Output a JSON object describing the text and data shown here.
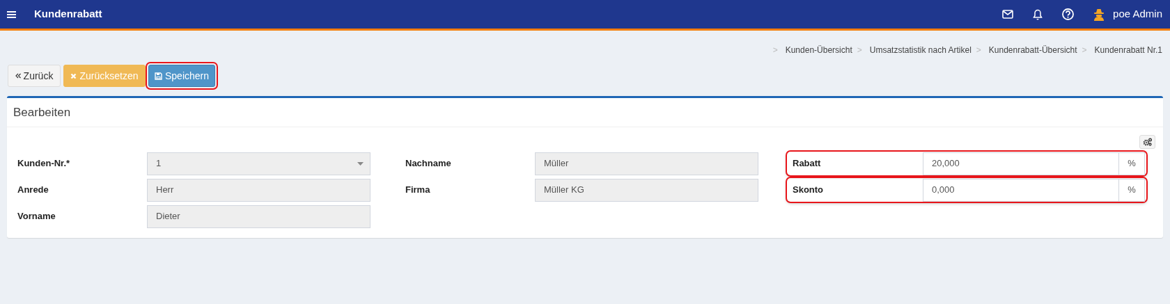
{
  "header": {
    "title": "Kundenrabatt",
    "user": "poe Admin"
  },
  "breadcrumb": [
    "Kunden-Übersicht",
    "Umsatzstatistik nach Artikel",
    "Kundenrabatt-Übersicht",
    "Kundenrabatt Nr.1"
  ],
  "breadcrumb_separator": ">",
  "buttons": [
    {
      "kind": "back",
      "label": "Zurück",
      "highlighted": false
    },
    {
      "kind": "reset",
      "label": "Zurücksetzen",
      "highlighted": false
    },
    {
      "kind": "save",
      "label": "Speichern",
      "highlighted": true
    }
  ],
  "card": {
    "title": "Bearbeiten",
    "columns": [
      [
        {
          "kind": "select",
          "label": "Kunden-Nr.*",
          "value": "1",
          "highlighted": false
        },
        {
          "kind": "readonly",
          "label": "Anrede",
          "value": "Herr",
          "highlighted": false
        },
        {
          "kind": "readonly",
          "label": "Vorname",
          "value": "Dieter",
          "highlighted": false
        }
      ],
      [
        {
          "kind": "readonly",
          "label": "Nachname",
          "value": "Müller",
          "highlighted": false
        },
        {
          "kind": "readonly",
          "label": "Firma",
          "value": "Müller KG",
          "highlighted": false
        }
      ],
      [
        {
          "kind": "addon",
          "label": "Rabatt",
          "value": "20,000",
          "addon": "%",
          "highlighted": true
        },
        {
          "kind": "addon",
          "label": "Skonto",
          "value": "0,000",
          "addon": "%",
          "highlighted": true
        }
      ]
    ]
  }
}
